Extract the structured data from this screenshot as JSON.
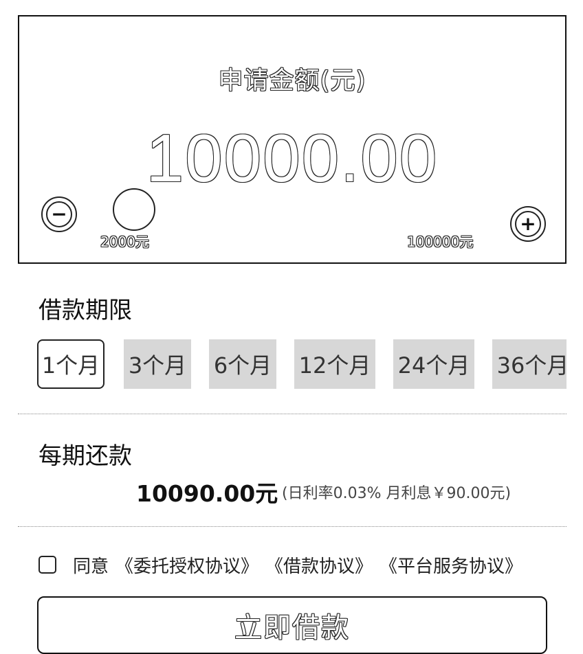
{
  "amount_card": {
    "title": "申请金额(元)",
    "value": "10000.00",
    "min_label": "2000元",
    "max_label": "100000元",
    "minus_icon": "minus-circle-icon",
    "plus_icon": "plus-circle-icon"
  },
  "term": {
    "title": "借款期限",
    "selected_index": 0,
    "options": [
      "1个月",
      "3个月",
      "6个月",
      "12个月",
      "24个月",
      "36个月"
    ]
  },
  "repayment": {
    "title": "每期还款",
    "amount": "10090.00元",
    "note": "(日利率0.03% 月利息￥90.00元)"
  },
  "agreement": {
    "agree_text": "同意",
    "links": [
      "《委托授权协议》",
      "《借款协议》",
      "《平台服务协议》"
    ]
  },
  "submit": {
    "label": "立即借款"
  }
}
